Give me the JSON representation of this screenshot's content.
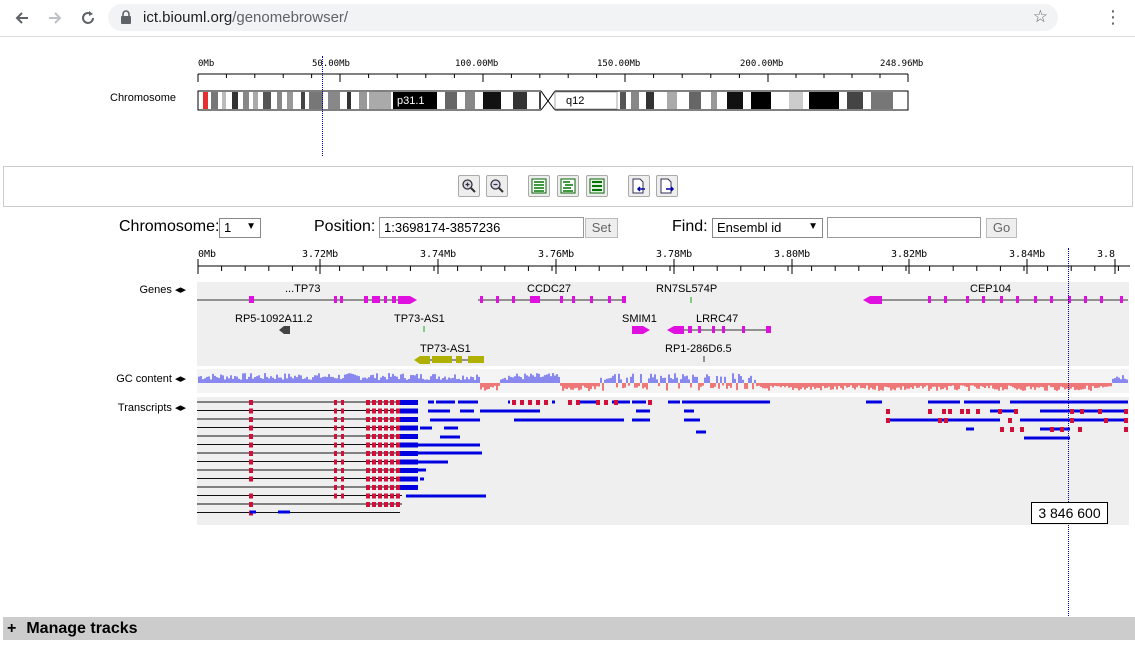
{
  "browser": {
    "url_host": "ict.biouml.org",
    "url_path": "/genomebrowser/"
  },
  "ideogram": {
    "row_label": "Chromosome",
    "ticks": [
      "0Mb",
      "50.00Mb",
      "100.00Mb",
      "150.00Mb",
      "200.00Mb",
      "248.96Mb"
    ],
    "band_labels": [
      "p31.1",
      "q12"
    ]
  },
  "controls": {
    "chromosome_label": "Chromosome:",
    "chromosome_value": "1",
    "position_label": "Position:",
    "position_value": "1:3698174-3857236",
    "set_label": "Set",
    "find_label": "Find:",
    "find_type": "Ensembl id",
    "find_value": "",
    "go_label": "Go"
  },
  "ruler": {
    "ticks": [
      "0Mb",
      "3.72Mb",
      "3.74Mb",
      "3.76Mb",
      "3.78Mb",
      "3.80Mb",
      "3.82Mb",
      "3.84Mb",
      "3.8"
    ]
  },
  "tracks": {
    "genes_label": "Genes",
    "gc_label": "GC content",
    "transcripts_label": "Transcripts"
  },
  "genes": [
    {
      "name": "...TP73"
    },
    {
      "name": "CCDC27"
    },
    {
      "name": "RN7SL574P"
    },
    {
      "name": "CEP104"
    },
    {
      "name": "RP5-1092A11.2"
    },
    {
      "name": "TP73-AS1"
    },
    {
      "name": "SMIM1"
    },
    {
      "name": "LRRC47"
    },
    {
      "name": "TP73-AS1"
    },
    {
      "name": "RP1-286D6.5"
    }
  ],
  "cursor_position": "3 846 600",
  "manage_tracks": {
    "plus": "+",
    "label": "Manage tracks"
  },
  "colors": {
    "exon_red": "#d0103a",
    "exon_blue": "#0000e0",
    "gene_magenta": "#e010e0",
    "gene_olive": "#b0b000",
    "gc_blue": "#8888ee",
    "gc_red": "#ee7777",
    "cursor_line": "#0000aa"
  },
  "icons": [
    "back-icon",
    "forward-icon",
    "reload-icon",
    "lock-icon",
    "star-icon",
    "menu-icon",
    "zoom-in-icon",
    "zoom-out-icon",
    "track-view-1-icon",
    "track-view-2-icon",
    "track-view-3-icon",
    "export-icon",
    "import-icon"
  ]
}
